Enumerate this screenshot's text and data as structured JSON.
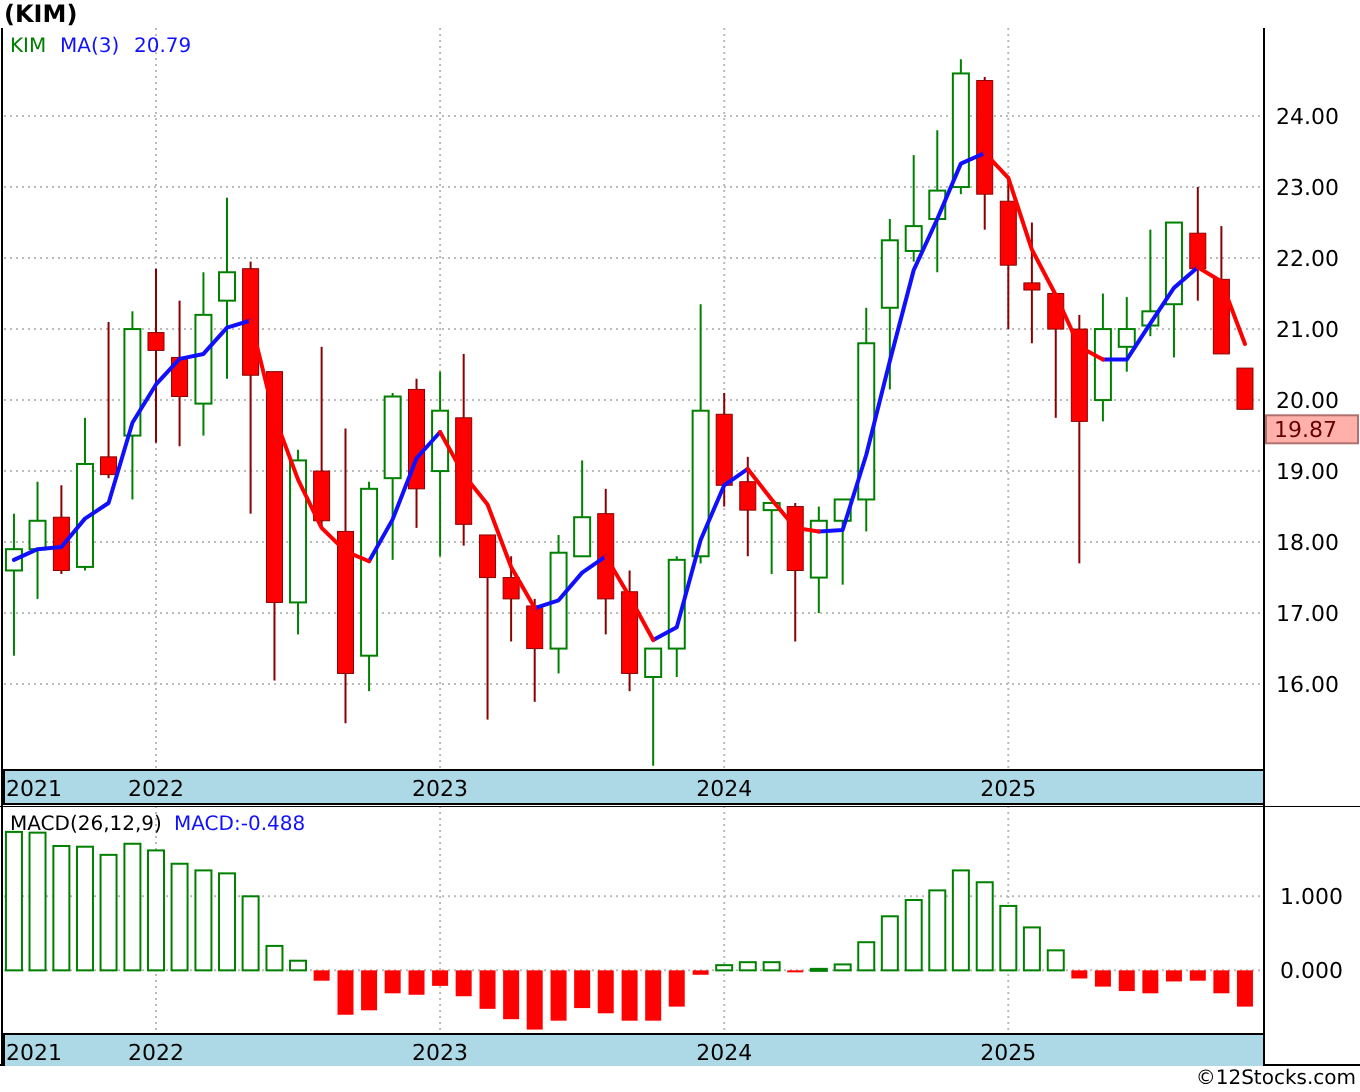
{
  "title": "(KIM)",
  "price_chart": {
    "ticker": "KIM",
    "ma_reading": "20.79",
    "last_price": "19.87",
    "chart_data": {
      "type": "candlestick",
      "grid": true,
      "ylim": [
        14.79,
        25.24
      ],
      "xlim": [
        2021.465,
        2025.9
      ],
      "x": [
        2021.5,
        2021.583,
        2021.667,
        2021.75,
        2021.833,
        2021.917,
        2022,
        2022.083,
        2022.167,
        2022.25,
        2022.333,
        2022.417,
        2022.5,
        2022.583,
        2022.667,
        2022.75,
        2022.833,
        2022.917,
        2023,
        2023.083,
        2023.167,
        2023.25,
        2023.333,
        2023.417,
        2023.5,
        2023.583,
        2023.667,
        2023.75,
        2023.833,
        2023.917,
        2024,
        2024.083,
        2024.167,
        2024.25,
        2024.333,
        2024.417,
        2024.5,
        2024.583,
        2024.667,
        2024.75,
        2024.833,
        2024.917,
        2025,
        2025.083,
        2025.167,
        2025.25,
        2025.333,
        2025.417,
        2025.5,
        2025.583,
        2025.667,
        2025.75,
        2025.833
      ],
      "yticks": [
        {
          "value": 16,
          "label": "16.00"
        },
        {
          "value": 17,
          "label": "17.00"
        },
        {
          "value": 18,
          "label": "18.00"
        },
        {
          "value": 19,
          "label": "19.00"
        },
        {
          "value": 20,
          "label": "20.00"
        },
        {
          "value": 21,
          "label": "21.00"
        },
        {
          "value": 22,
          "label": "22.00"
        },
        {
          "value": 23,
          "label": "23.00"
        },
        {
          "value": 24,
          "label": "24.00"
        }
      ],
      "xticks": [
        {
          "value": 2021.5,
          "label": "2021"
        },
        {
          "value": 2022,
          "label": "2022"
        },
        {
          "value": 2023,
          "label": "2023"
        },
        {
          "value": 2024,
          "label": "2024"
        },
        {
          "value": 2025,
          "label": "2025"
        }
      ],
      "ohlc": [
        [
          17.6,
          18.4,
          16.4,
          17.9
        ],
        [
          17.9,
          18.85,
          17.2,
          18.3
        ],
        [
          18.35,
          18.8,
          17.55,
          17.6
        ],
        [
          17.65,
          19.75,
          17.6,
          19.1
        ],
        [
          19.2,
          21.1,
          18.9,
          18.95
        ],
        [
          19.5,
          21.25,
          18.6,
          21.0
        ],
        [
          20.95,
          21.85,
          19.4,
          20.7
        ],
        [
          20.6,
          21.4,
          19.35,
          20.05
        ],
        [
          19.95,
          21.8,
          19.5,
          21.2
        ],
        [
          21.4,
          22.85,
          20.3,
          21.8
        ],
        [
          21.85,
          21.95,
          18.4,
          20.35
        ],
        [
          20.4,
          20.4,
          16.05,
          17.15
        ],
        [
          17.15,
          19.3,
          16.7,
          19.15
        ],
        [
          19.0,
          20.75,
          18.2,
          18.3
        ],
        [
          18.15,
          19.6,
          15.45,
          16.15
        ],
        [
          16.4,
          18.85,
          15.9,
          18.75
        ],
        [
          18.9,
          20.1,
          17.75,
          20.05
        ],
        [
          20.15,
          20.3,
          18.2,
          18.75
        ],
        [
          19.0,
          20.4,
          17.8,
          19.85
        ],
        [
          19.75,
          20.65,
          17.95,
          18.25
        ],
        [
          18.1,
          18.1,
          15.5,
          17.5
        ],
        [
          17.5,
          17.8,
          16.6,
          17.2
        ],
        [
          17.1,
          17.2,
          15.75,
          16.5
        ],
        [
          16.5,
          18.1,
          16.15,
          17.85
        ],
        [
          17.8,
          19.15,
          17.8,
          18.35
        ],
        [
          18.4,
          18.75,
          16.7,
          17.2
        ],
        [
          17.3,
          17.6,
          15.9,
          16.15
        ],
        [
          16.1,
          16.5,
          14.85,
          16.5
        ],
        [
          16.5,
          17.8,
          16.1,
          17.75
        ],
        [
          17.8,
          21.35,
          17.7,
          19.85
        ],
        [
          19.8,
          20.1,
          18.5,
          18.8
        ],
        [
          18.85,
          19.2,
          17.8,
          18.45
        ],
        [
          18.45,
          18.55,
          17.55,
          18.55
        ],
        [
          18.5,
          18.55,
          16.6,
          17.6
        ],
        [
          17.5,
          18.5,
          17.0,
          18.3
        ],
        [
          18.3,
          18.6,
          17.4,
          18.6
        ],
        [
          18.6,
          21.3,
          18.15,
          20.8
        ],
        [
          21.3,
          22.55,
          20.15,
          22.25
        ],
        [
          22.1,
          23.45,
          21.95,
          22.45
        ],
        [
          22.55,
          23.8,
          21.8,
          22.95
        ],
        [
          23.0,
          24.8,
          22.9,
          24.6
        ],
        [
          24.5,
          24.55,
          22.4,
          22.9
        ],
        [
          22.8,
          23.1,
          21.0,
          21.9
        ],
        [
          21.65,
          22.5,
          20.8,
          21.55
        ],
        [
          21.5,
          21.5,
          19.75,
          21.0
        ],
        [
          21.0,
          21.2,
          17.7,
          19.7
        ],
        [
          20.0,
          21.5,
          19.7,
          21.0
        ],
        [
          20.75,
          21.45,
          20.4,
          21.0
        ],
        [
          21.05,
          22.4,
          20.9,
          21.25
        ],
        [
          21.35,
          22.5,
          20.6,
          22.5
        ],
        [
          22.35,
          23.0,
          21.4,
          21.85
        ],
        [
          21.7,
          22.45,
          20.65,
          20.65
        ],
        [
          20.45,
          20.45,
          19.87,
          19.87
        ]
      ],
      "series": [
        {
          "name": "MA(3)",
          "type": "line",
          "color": "#1010ff",
          "values": [
            17.75,
            17.9,
            17.93,
            18.33,
            18.55,
            19.68,
            20.22,
            20.58,
            20.65,
            21.02,
            21.12,
            null,
            null,
            null,
            null,
            17.73,
            18.32,
            19.18,
            19.55,
            null,
            null,
            null,
            17.07,
            17.18,
            17.57,
            17.8,
            null,
            16.62,
            16.8,
            18.03,
            18.8,
            19.03,
            null,
            null,
            18.15,
            18.17,
            19.23,
            20.55,
            21.83,
            22.55,
            23.33,
            23.48,
            null,
            null,
            null,
            null,
            20.57,
            20.57,
            21.08,
            21.58,
            21.87,
            null,
            null
          ]
        },
        {
          "type": "line",
          "color": "#ff0000",
          "values": [
            null,
            null,
            null,
            null,
            null,
            null,
            null,
            null,
            null,
            null,
            21.12,
            19.77,
            18.88,
            18.2,
            17.87,
            17.73,
            null,
            null,
            19.55,
            18.95,
            18.53,
            17.65,
            17.07,
            null,
            null,
            17.8,
            17.23,
            16.62,
            null,
            null,
            null,
            19.03,
            18.6,
            18.2,
            18.15,
            null,
            null,
            null,
            null,
            null,
            null,
            23.48,
            23.13,
            22.12,
            21.48,
            20.75,
            20.57,
            null,
            null,
            null,
            21.87,
            21.67,
            20.79
          ]
        }
      ]
    }
  },
  "macd_chart": {
    "reading": "MACD:-0.488",
    "chart_data": {
      "type": "bar",
      "grid": true,
      "ylim": [
        -0.86,
        2.22
      ],
      "xlim": [
        2021.465,
        2025.9
      ],
      "x": [
        2021.5,
        2021.583,
        2021.667,
        2021.75,
        2021.833,
        2021.917,
        2022,
        2022.083,
        2022.167,
        2022.25,
        2022.333,
        2022.417,
        2022.5,
        2022.583,
        2022.667,
        2022.75,
        2022.833,
        2022.917,
        2023,
        2023.083,
        2023.167,
        2023.25,
        2023.333,
        2023.417,
        2023.5,
        2023.583,
        2023.667,
        2023.75,
        2023.833,
        2023.917,
        2024,
        2024.083,
        2024.167,
        2024.25,
        2024.333,
        2024.417,
        2024.5,
        2024.583,
        2024.667,
        2024.75,
        2024.833,
        2024.917,
        2025,
        2025.083,
        2025.167,
        2025.25,
        2025.333,
        2025.417,
        2025.5,
        2025.583,
        2025.667,
        2025.75,
        2025.833
      ],
      "yticks": [
        {
          "value": 0,
          "label": "0.000"
        },
        {
          "value": 1,
          "label": "1.000"
        }
      ],
      "xticks": [
        {
          "value": 2021.5,
          "label": "2021"
        },
        {
          "value": 2022,
          "label": "2022"
        },
        {
          "value": 2023,
          "label": "2023"
        },
        {
          "value": 2024,
          "label": "2024"
        },
        {
          "value": 2025,
          "label": "2025"
        }
      ],
      "series": [
        {
          "name": "MACD(26,12,9)",
          "values": [
            1.87,
            1.86,
            1.68,
            1.67,
            1.56,
            1.71,
            1.62,
            1.44,
            1.35,
            1.31,
            1.0,
            0.33,
            0.13,
            -0.14,
            -0.6,
            -0.54,
            -0.31,
            -0.33,
            -0.21,
            -0.35,
            -0.52,
            -0.66,
            -0.8,
            -0.68,
            -0.51,
            -0.58,
            -0.68,
            -0.68,
            -0.49,
            -0.06,
            0.07,
            0.11,
            0.11,
            -0.01,
            0.02,
            0.08,
            0.38,
            0.73,
            0.95,
            1.08,
            1.35,
            1.19,
            0.87,
            0.58,
            0.27,
            -0.11,
            -0.22,
            -0.28,
            -0.31,
            -0.15,
            -0.14,
            -0.31,
            -0.49
          ]
        }
      ]
    }
  },
  "credit": "©12Stocks.com"
}
